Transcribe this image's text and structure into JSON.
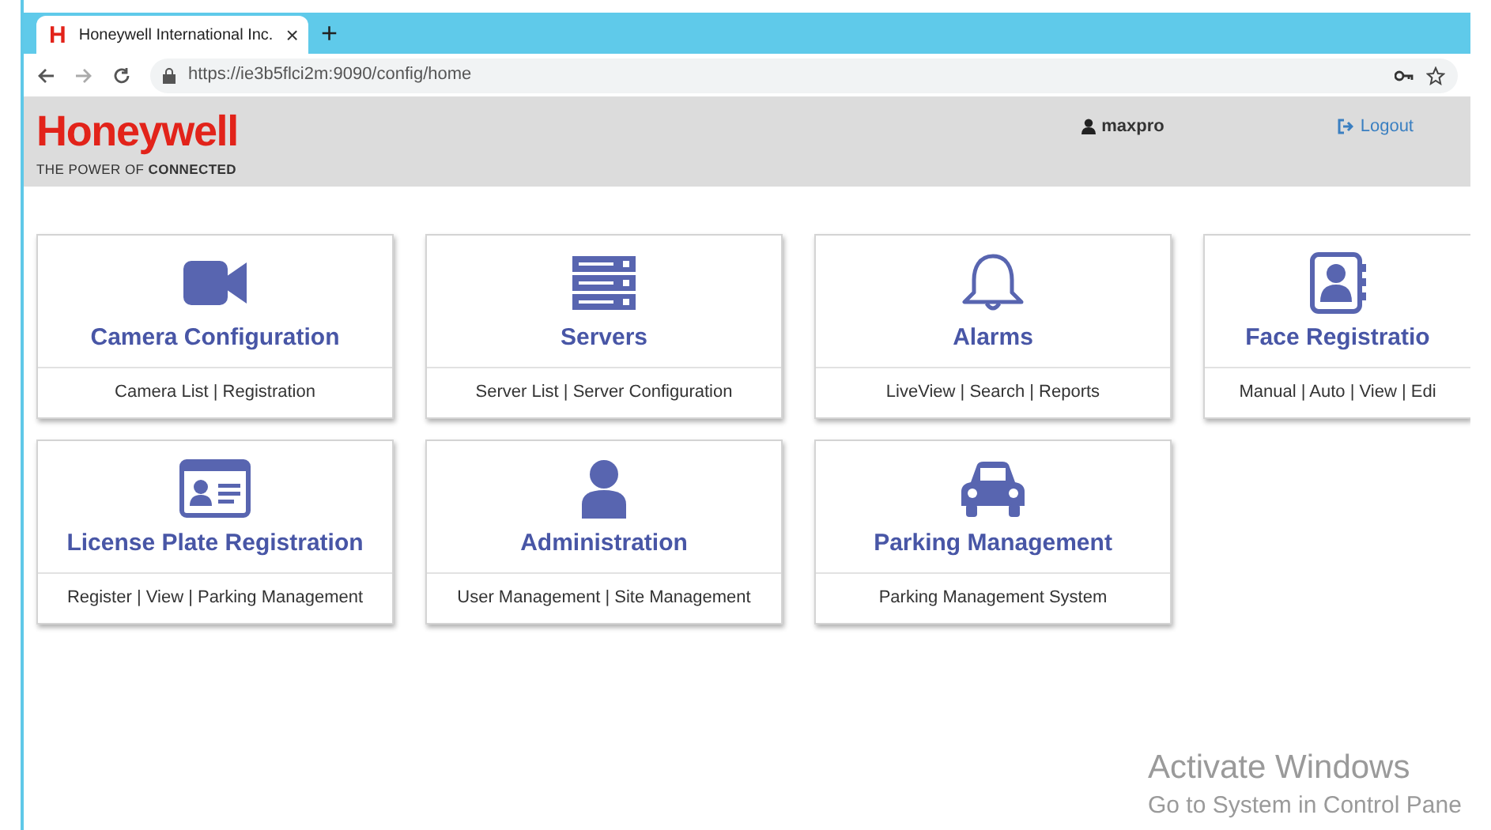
{
  "browser": {
    "tab": {
      "logo": "H",
      "title": "Honeywell International Inc.",
      "close": "×",
      "selected": true
    },
    "new_tab": "+",
    "url": "https://ie3b5flci2m:9090/config/home"
  },
  "header": {
    "brand": "Honeywell",
    "tagline": "THE POWER OF **CONNECTED**",
    "user": "maxpro",
    "logout": "Logout"
  },
  "cards": [
    {
      "kind": "camera",
      "title": "Camera Configuration",
      "links": "Camera List | Registration"
    },
    {
      "kind": "servers",
      "title": "Servers",
      "links": "Server List | Server Configuration"
    },
    {
      "kind": "bell",
      "title": "Alarms",
      "links": "LiveView | Search | Reports"
    },
    {
      "kind": "contacts",
      "title": "Face Registratio",
      "links": "Manual | Auto | View | Edi",
      "cut": true
    },
    {
      "kind": "idcard",
      "title": "License Plate Registration",
      "links": "Register | View | Parking Management"
    },
    {
      "kind": "user",
      "title": "Administration",
      "links": "User Management | Site Management"
    },
    {
      "kind": "car",
      "title": "Parking Management",
      "links": "Parking Management System"
    }
  ],
  "os_notice": {
    "title": "Activate Windows",
    "text": "Go to System in Control Pane"
  }
}
